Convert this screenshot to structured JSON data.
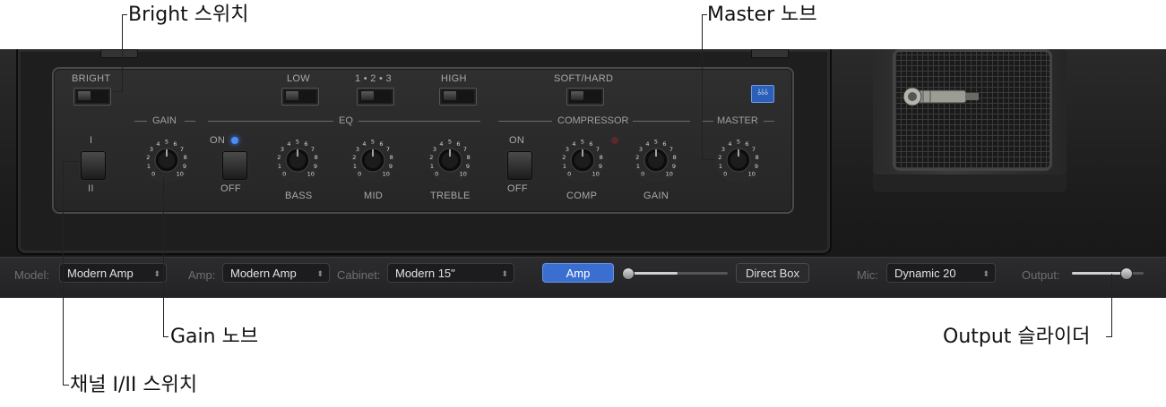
{
  "callouts": {
    "bright_switch": "Bright 스위치",
    "master_knob": "Master 노브",
    "gain_knob": "Gain 노브",
    "output_slider": "Output 슬라이더",
    "channel_switch": "채널 I/II 스위치"
  },
  "panel": {
    "bright": "BRIGHT",
    "low": "LOW",
    "mid_select": "1 • 2 • 3",
    "high": "HIGH",
    "soft_hard": "SOFT/HARD",
    "eq_button": "⫰⫰⫰",
    "section_gain": "GAIN",
    "section_eq": "EQ",
    "section_compressor": "COMPRESSOR",
    "section_master": "MASTER",
    "channel_top": "I",
    "channel_bottom": "II",
    "eq_on": "ON",
    "eq_off": "OFF",
    "comp_on": "ON",
    "comp_off": "OFF",
    "bass": "BASS",
    "mid": "MID",
    "treble": "TREBLE",
    "comp": "COMP",
    "gain2": "GAIN"
  },
  "knob_scale": [
    "0",
    "1",
    "2",
    "3",
    "4",
    "5",
    "6",
    "7",
    "8",
    "9",
    "10"
  ],
  "bottom_bar": {
    "model_label": "Model:",
    "model_value": "Modern Amp",
    "amp_label": "Amp:",
    "amp_value": "Modern Amp",
    "cabinet_label": "Cabinet:",
    "cabinet_value": "Modern 15\"",
    "amp_button": "Amp",
    "direct_box_button": "Direct Box",
    "mic_label": "Mic:",
    "mic_value": "Dynamic 20",
    "output_label": "Output:",
    "chevron": "⬍"
  },
  "state": {
    "eq_led_on": true,
    "comp_led_on": false,
    "amp_direct_mix": 0.0,
    "output_level": 0.75
  },
  "colors": {
    "accent_blue": "#3a6fd1",
    "led_blue": "#4a8cff",
    "led_off_red": "#5a2a2a"
  }
}
